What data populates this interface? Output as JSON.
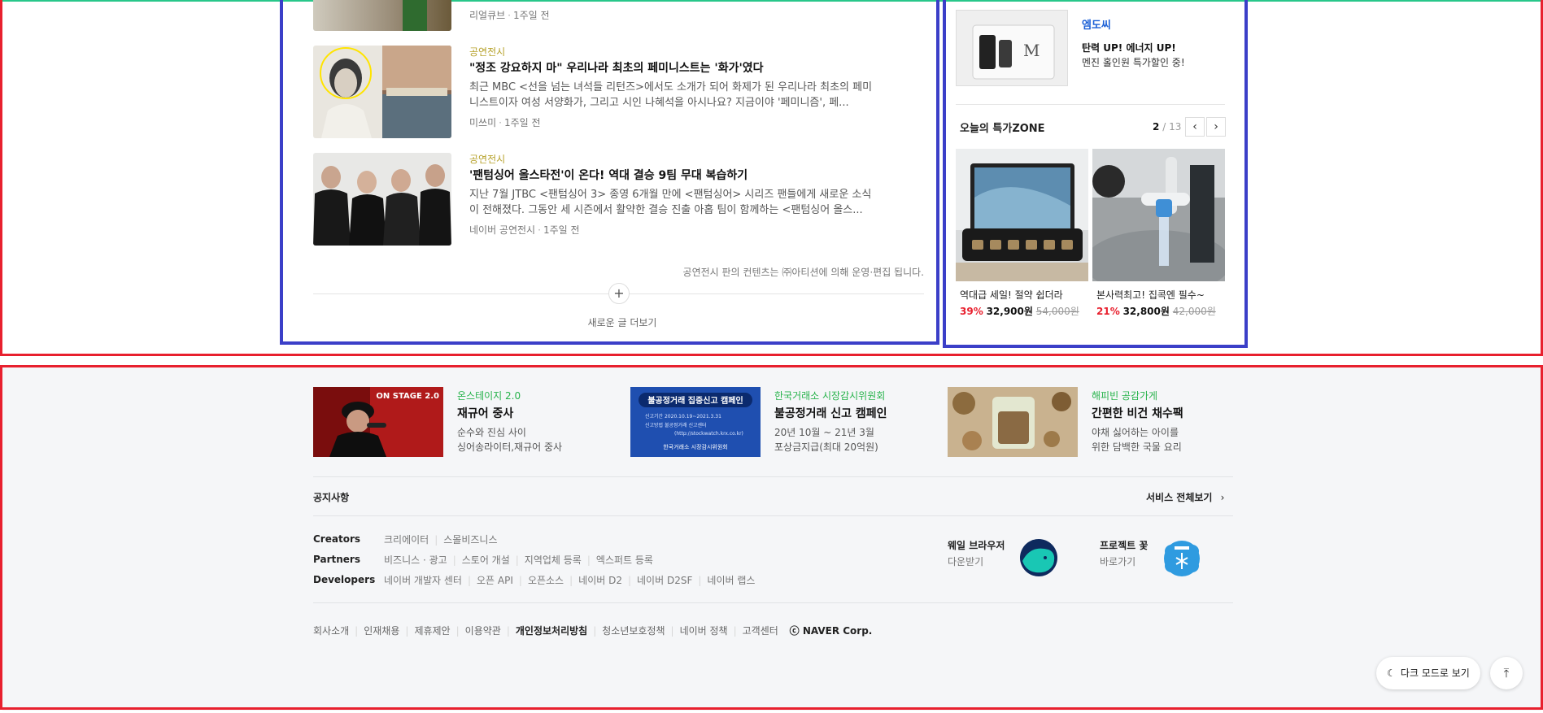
{
  "news": {
    "top_item_meta": {
      "source": "리얼큐브",
      "time": "1주일 전"
    },
    "items": [
      {
        "category": "공연전시",
        "title": "\"정조 강요하지 마\" 우리나라 최초의 페미니스트는 '화가'였다",
        "summary": "최근 MBC <선을 넘는 녀석들 리턴즈>에서도 소개가 되어 화제가 된 우리나라 최초의 페미니스트이자 여성 서양화가, 그리고 시인 나혜석을 아시나요? 지금이야 '페미니즘', 페...",
        "source": "미쓰미",
        "time": "1주일 전"
      },
      {
        "category": "공연전시",
        "title": "'팬텀싱어 올스타전'이 온다! 역대 결승 9팀 무대 복습하기",
        "summary": "지난 7월 JTBC <팬텀싱어 3> 종영 6개월 만에 <팬텀싱어> 시리즈 팬들에게 새로운 소식이 전해졌다. 그동안 세 시즌에서 활약한 결승 진출 아홉 팀이 함께하는 <팬텀싱어 올스...",
        "source": "네이버 공연전시",
        "time": "1주일 전"
      }
    ],
    "notice": "공연전시 판의 컨텐츠는 ㈜아티션에 의해 운영·편집 됩니다.",
    "more_button_icon": "plus-icon",
    "more_label": "새로운 글 더보기"
  },
  "sidebar": {
    "ad": {
      "brand": "엠도씨",
      "line1": "탄력 UP! 에너지 UP!",
      "line2": "멘진 홀인원 특가할인 중!"
    },
    "deal": {
      "title": "오늘의 특가ZONE",
      "page_current": "2",
      "page_sep": "/",
      "page_total": "13",
      "products": [
        {
          "name": "역대급 세일! 절약 쉽더라",
          "discount": "39%",
          "price": "32,900원",
          "original": "54,000원"
        },
        {
          "name": "본사력최고! 집콕엔 필수~",
          "discount": "21%",
          "price": "32,800원",
          "original": "42,000원"
        }
      ]
    }
  },
  "footer": {
    "promos": [
      {
        "image_text": "ON STAGE 2.0",
        "category": "온스테이지 2.0",
        "title": "재규어 중사",
        "desc1": "순수와 진심 사이",
        "desc2": "싱어송라이터,재규어 중사"
      },
      {
        "image_text": "불공정거래 집중신고 캠페인",
        "category": "한국거래소 시장감시위원회",
        "title": "불공정거래 신고 캠페인",
        "desc1": "20년 10월 ~ 21년 3월",
        "desc2": "포상금지급(최대 20억원)"
      },
      {
        "image_text": "",
        "category": "해피빈 공감가게",
        "title": "간편한 비건 채수팩",
        "desc1": "야채 싫어하는 아이를",
        "desc2": "위한 담백한 국물 요리"
      }
    ],
    "promo_img_labels": {
      "p1_period": "신고기간  2020.10.19~2021.3.31",
      "p1_method": "신고방법  불공정거래 신고센터",
      "p1_url": "(http://stockwatch.krx.co.kr)",
      "p1_org": "한국거래소 시장감시위원회"
    },
    "notice_label": "공지사항",
    "service_all": "서비스 전체보기",
    "rows": [
      {
        "label": "Creators",
        "links": [
          "크리에이터",
          "스몰비즈니스"
        ]
      },
      {
        "label": "Partners",
        "links": [
          "비즈니스 · 광고",
          "스토어 개설",
          "지역업체 등록",
          "엑스퍼트 등록"
        ]
      },
      {
        "label": "Developers",
        "links": [
          "네이버 개발자 센터",
          "오픈 API",
          "오픈소스",
          "네이버 D2",
          "네이버 D2SF",
          "네이버 랩스"
        ]
      }
    ],
    "apps": [
      {
        "title": "웨일 브라우저",
        "sub": "다운받기"
      },
      {
        "title": "프로젝트 꽃",
        "sub": "바로가기"
      }
    ],
    "bottom_links": [
      "회사소개",
      "인재채용",
      "제휴제안",
      "이용약관",
      "개인정보처리방침",
      "청소년보호정책",
      "네이버 정책",
      "고객센터"
    ],
    "copyright": "ⓒ NAVER Corp.",
    "dark_mode": "다크 모드로 보기"
  },
  "colors": {
    "category": "#b6a12a",
    "promo_category": "#27b34b",
    "discount": "#e8202e",
    "brand_link": "#1a5fd6",
    "overlay_red": "#e8202e",
    "overlay_blue": "#3b3fc8"
  }
}
